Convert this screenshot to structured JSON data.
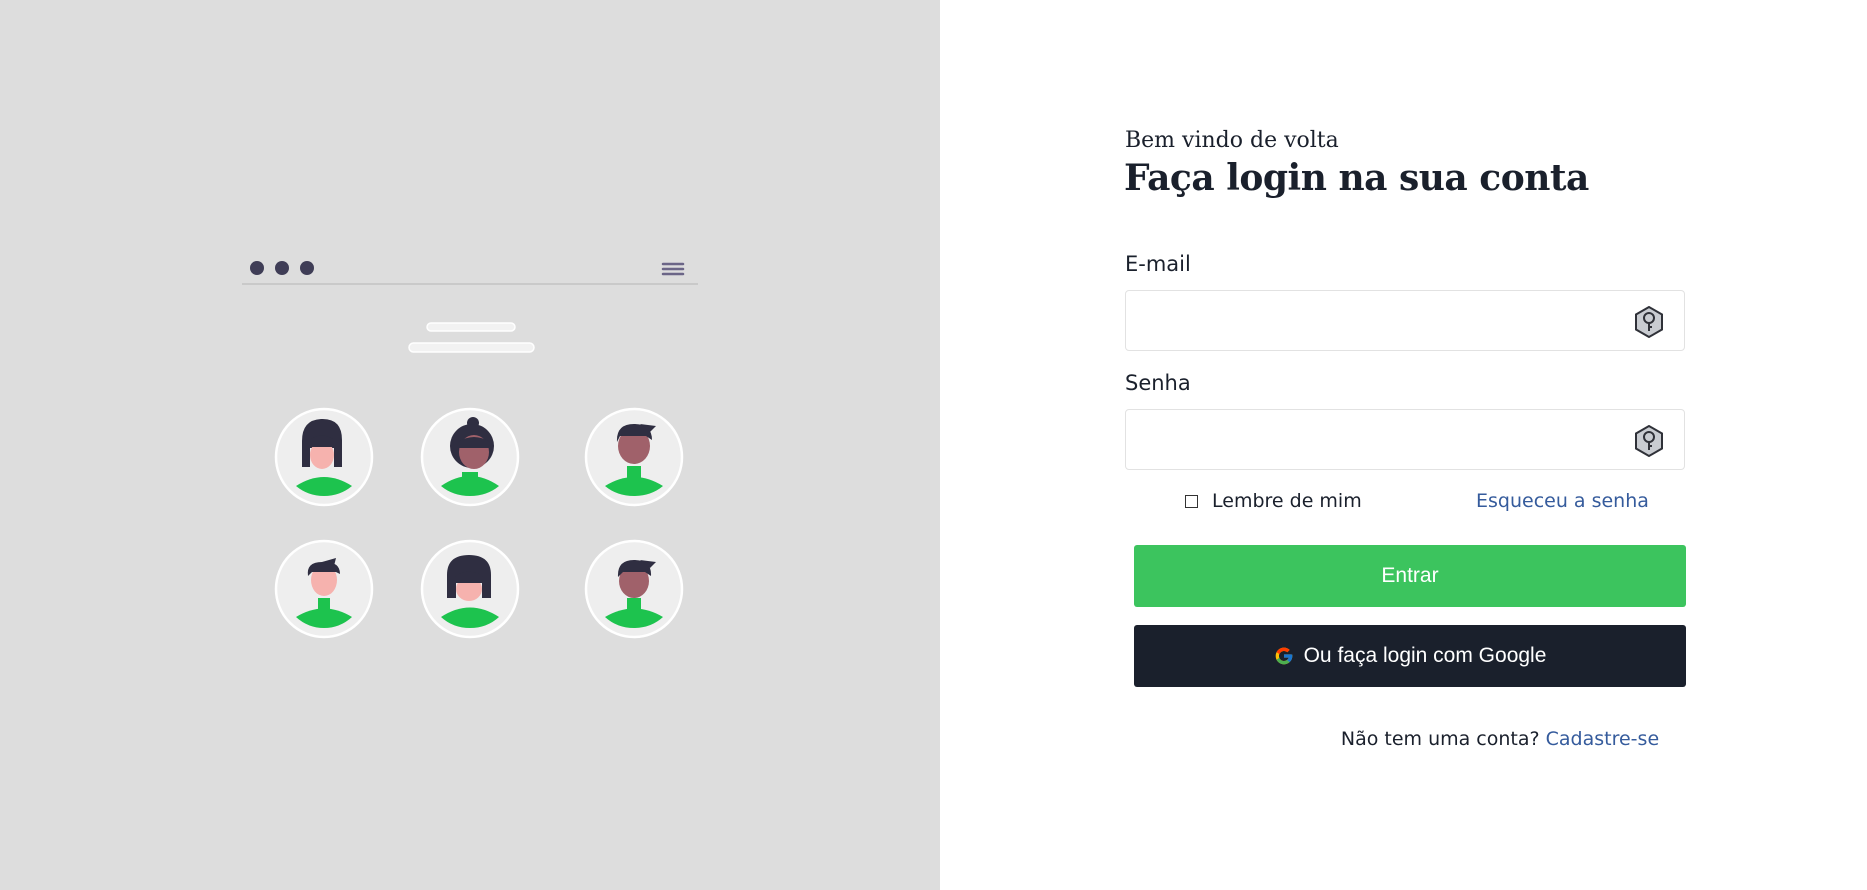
{
  "greeting": "Bem vindo de volta",
  "title": "Faça login na sua conta",
  "form": {
    "email_label": "E-mail",
    "email_value": "",
    "password_label": "Senha",
    "password_value": "",
    "remember_label": "Lembre de mim",
    "remember_checked": false,
    "forgot_link": "Esqueceu a senha",
    "submit_label": "Entrar",
    "google_label": "Ou faça login com Google"
  },
  "signup": {
    "prompt": "Não tem uma conta?",
    "link": "Cadastre-se"
  },
  "icons": {
    "field_icon": "key-hexagon-icon",
    "google_icon": "google-g-icon"
  },
  "colors": {
    "left_panel_bg": "#dddddd",
    "primary_button": "#3cc45e",
    "google_button": "#1a202c",
    "link": "#355b9c",
    "illustration_accent": "#1dc34e",
    "text": "#1a202c"
  }
}
